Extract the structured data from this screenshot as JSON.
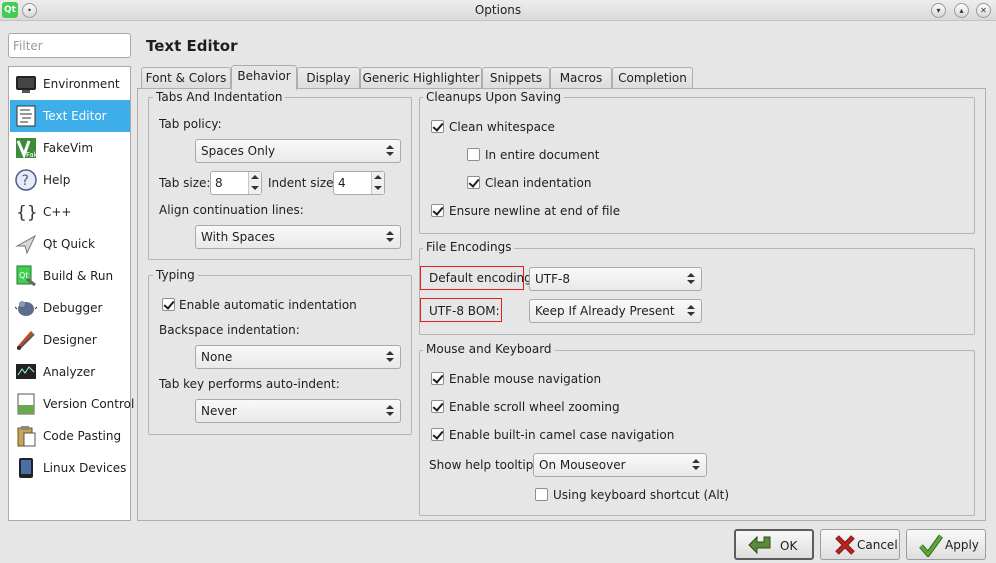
{
  "window": {
    "title": "Options"
  },
  "filter": {
    "placeholder": "Filter"
  },
  "sidebar": {
    "items": [
      {
        "label": "Environment",
        "icon": "monitor-icon"
      },
      {
        "label": "Text Editor",
        "icon": "text-editor-icon",
        "selected": true
      },
      {
        "label": "FakeVim",
        "icon": "fakevim-icon"
      },
      {
        "label": "Help",
        "icon": "help-icon"
      },
      {
        "label": "C++",
        "icon": "braces-icon"
      },
      {
        "label": "Qt Quick",
        "icon": "qt-quick-icon"
      },
      {
        "label": "Build & Run",
        "icon": "build-run-icon"
      },
      {
        "label": "Debugger",
        "icon": "bug-icon"
      },
      {
        "label": "Designer",
        "icon": "designer-icon"
      },
      {
        "label": "Analyzer",
        "icon": "analyzer-icon"
      },
      {
        "label": "Version Control",
        "icon": "version-control-icon"
      },
      {
        "label": "Code Pasting",
        "icon": "clipboard-icon"
      },
      {
        "label": "Linux Devices",
        "icon": "device-icon"
      }
    ]
  },
  "page": {
    "title": "Text Editor"
  },
  "tabs": [
    "Font & Colors",
    "Behavior",
    "Display",
    "Generic Highlighter",
    "Snippets",
    "Macros",
    "Completion"
  ],
  "tabs_and_indentation": {
    "title": "Tabs And Indentation",
    "tab_policy_label": "Tab policy:",
    "tab_policy_value": "Spaces Only",
    "tab_size_label": "Tab size:",
    "tab_size_value": "8",
    "indent_size_label": "Indent size:",
    "indent_size_value": "4",
    "align_label": "Align continuation lines:",
    "align_value": "With Spaces"
  },
  "typing": {
    "title": "Typing",
    "auto_indent_label": "Enable automatic indentation",
    "auto_indent_checked": true,
    "backspace_label": "Backspace indentation:",
    "backspace_value": "None",
    "tabkey_label": "Tab key performs auto-indent:",
    "tabkey_value": "Never"
  },
  "cleanups": {
    "title": "Cleanups Upon Saving",
    "clean_whitespace": {
      "label": "Clean whitespace",
      "checked": true
    },
    "entire_document": {
      "label": "In entire document",
      "checked": false
    },
    "clean_indentation": {
      "label": "Clean indentation",
      "checked": true
    },
    "ensure_newline": {
      "label": "Ensure newline at end of file",
      "checked": true
    }
  },
  "file_encodings": {
    "title": "File Encodings",
    "default_label": "Default encoding:",
    "default_value": "UTF-8",
    "bom_label": "UTF-8 BOM:",
    "bom_value": "Keep If Already Present"
  },
  "mouse_keyboard": {
    "title": "Mouse and Keyboard",
    "mouse_nav": {
      "label": "Enable mouse navigation",
      "checked": true
    },
    "scroll_zoom": {
      "label": "Enable scroll wheel zooming",
      "checked": true
    },
    "camel_nav": {
      "label": "Enable built-in camel case navigation",
      "checked": true
    },
    "tooltips_label": "Show help tooltips:",
    "tooltips_value": "On Mouseover",
    "kbd_shortcut": {
      "label": "Using keyboard shortcut (Alt)",
      "checked": false
    }
  },
  "buttons": {
    "ok": "OK",
    "cancel": "Cancel",
    "apply": "Apply"
  },
  "colors": {
    "selection": "#3daee9",
    "highlight_border": "#e02020"
  }
}
